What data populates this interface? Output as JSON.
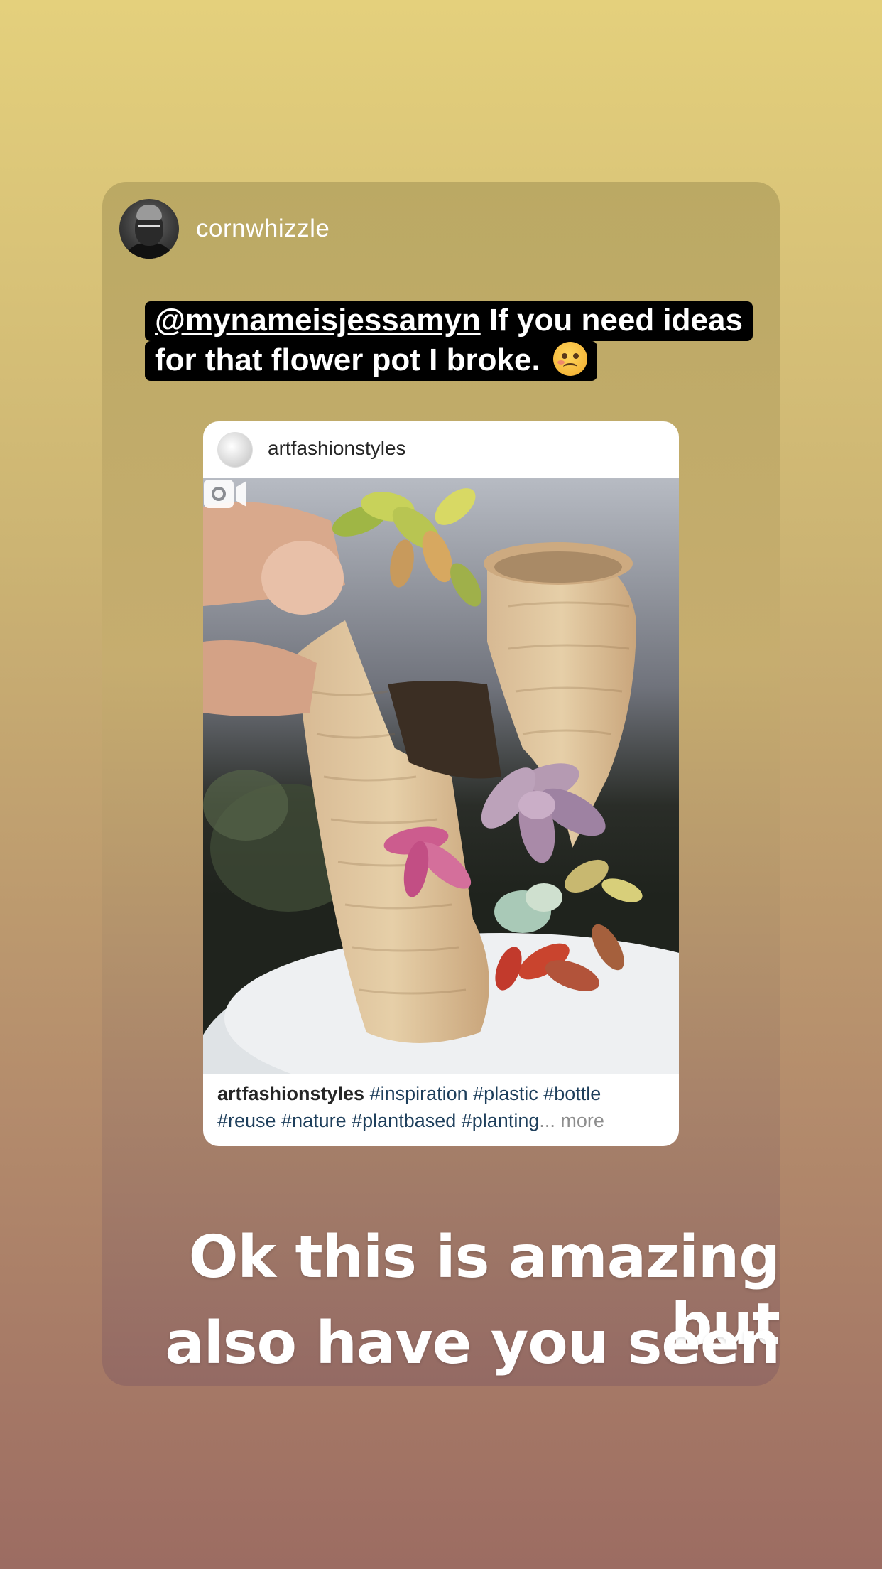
{
  "story": {
    "username": "cornwhizzle",
    "caption_mention": "@mynameisjessamyn",
    "caption_line1_rest": " If you need ideas",
    "caption_line2": "for that flower pot I broke.",
    "emoji": "woozy-face",
    "overlay_line1": "Ok this is amazing but",
    "overlay_line2": "also have you seen"
  },
  "shared_post": {
    "username": "artfashionstyles",
    "caption_user": "artfashionstyles",
    "caption_tags_line1": " #inspiration #plastic #bottle",
    "caption_tags_line2": "#reuse #nature #plantbased #planting",
    "caption_ellipsis": "...",
    "caption_more": " more",
    "media_type_icon": "video-camera-icon"
  },
  "colors": {
    "background_top": "#e4d07c",
    "background_bottom": "#9c6c62",
    "tag_color": "#1e3f5c"
  }
}
